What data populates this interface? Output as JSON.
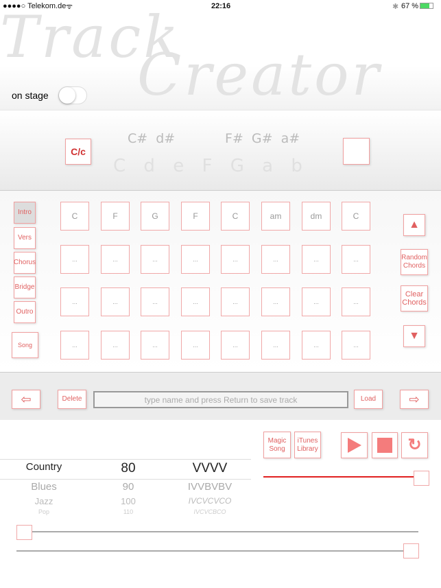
{
  "status": {
    "carrier": "●●●●○ Telekom.de",
    "time": "22:16",
    "battery": "67 %"
  },
  "logo": {
    "line1": "Track",
    "line2": "Creator"
  },
  "on_stage": {
    "label": "on stage",
    "on": false
  },
  "key": {
    "button": "C/c",
    "sharps": [
      "C#",
      "d#",
      "F#",
      "G#",
      "a#"
    ],
    "naturals": [
      "C",
      "d",
      "e",
      "F",
      "G",
      "a",
      "b"
    ]
  },
  "sections": [
    "Intro",
    "Vers",
    "Chorus",
    "Bridge",
    "Outro",
    "Song"
  ],
  "chords": [
    [
      "C",
      "F",
      "G",
      "F",
      "C",
      "am",
      "dm",
      "C"
    ],
    [
      "...",
      "...",
      "...",
      "...",
      "...",
      "...",
      "...",
      "..."
    ],
    [
      "...",
      "...",
      "...",
      "...",
      "...",
      "...",
      "...",
      "..."
    ],
    [
      "...",
      "...",
      "...",
      "...",
      "...",
      "...",
      "...",
      "..."
    ]
  ],
  "right_buttons": {
    "up": "▲",
    "random": "Random Chords",
    "clear": "Clear Chords",
    "down": "▼"
  },
  "bar": {
    "prev": "⇦",
    "delete": "Delete",
    "placeholder": "type name and press Return to save track",
    "load": "Load",
    "next": "⇨"
  },
  "controls": {
    "magic": "Magic Song",
    "itunes": "iTunes Library",
    "volume": 0.95
  },
  "picker": {
    "genres": [
      "Country",
      "Blues",
      "Jazz",
      "Pop"
    ],
    "tempos": [
      "80",
      "90",
      "100",
      "110"
    ],
    "patterns": [
      "VVVV",
      "IVVBVBV",
      "IVCVCVCO",
      "IVCVCBCO"
    ]
  },
  "sliders": [
    0.0,
    1.0
  ],
  "colors": {
    "accent": "#f47c7c",
    "red_line": "#e02020"
  }
}
